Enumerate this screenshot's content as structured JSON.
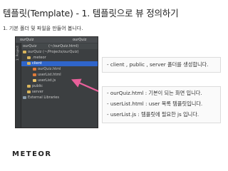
{
  "title": "템플릿(Template) - 1. 템플릿으로 뷰 정의하기",
  "subtitle": "1. 기본 폴더 및 파일을 만들어 봅니다.",
  "ide": {
    "top_left": "ourQuiz",
    "top_right": "ourQuiz",
    "strip_label": "1: Project",
    "header": "ourQuiz",
    "header_path": "(~/ourQuiz.html)",
    "tree": [
      {
        "label": "ourQuiz (~/Projects/ourQuiz)",
        "icon": "folder-icon"
      },
      {
        "label": ".meteor",
        "icon": "folder-icon"
      },
      {
        "label": "client",
        "icon": "folder-icon",
        "selected": true
      },
      {
        "label": "ourQuiz.html",
        "icon": "html-file-icon"
      },
      {
        "label": "userList.html",
        "icon": "html-file-icon"
      },
      {
        "label": "userList.js",
        "icon": "js-file-icon"
      },
      {
        "label": "public",
        "icon": "folder-icon"
      },
      {
        "label": "server",
        "icon": "folder-icon"
      },
      {
        "label": "External Libraries",
        "icon": "library-icon"
      }
    ]
  },
  "note": "- client , public , server 폴더를 생성합니다.",
  "list": [
    "- ourQuiz.html : 기본이 되는 화면 입니다.",
    "- userList.html : user 목록 템플릿입니다.",
    "- userList.js : 템플릿에 필요한 js 입니다."
  ],
  "logo": {
    "text": "METEOR",
    "accent": "#d9514e"
  },
  "colors": {
    "arrow": "#e8609a",
    "ide_bg": "#3c3f41",
    "selection": "#2f65ca"
  }
}
